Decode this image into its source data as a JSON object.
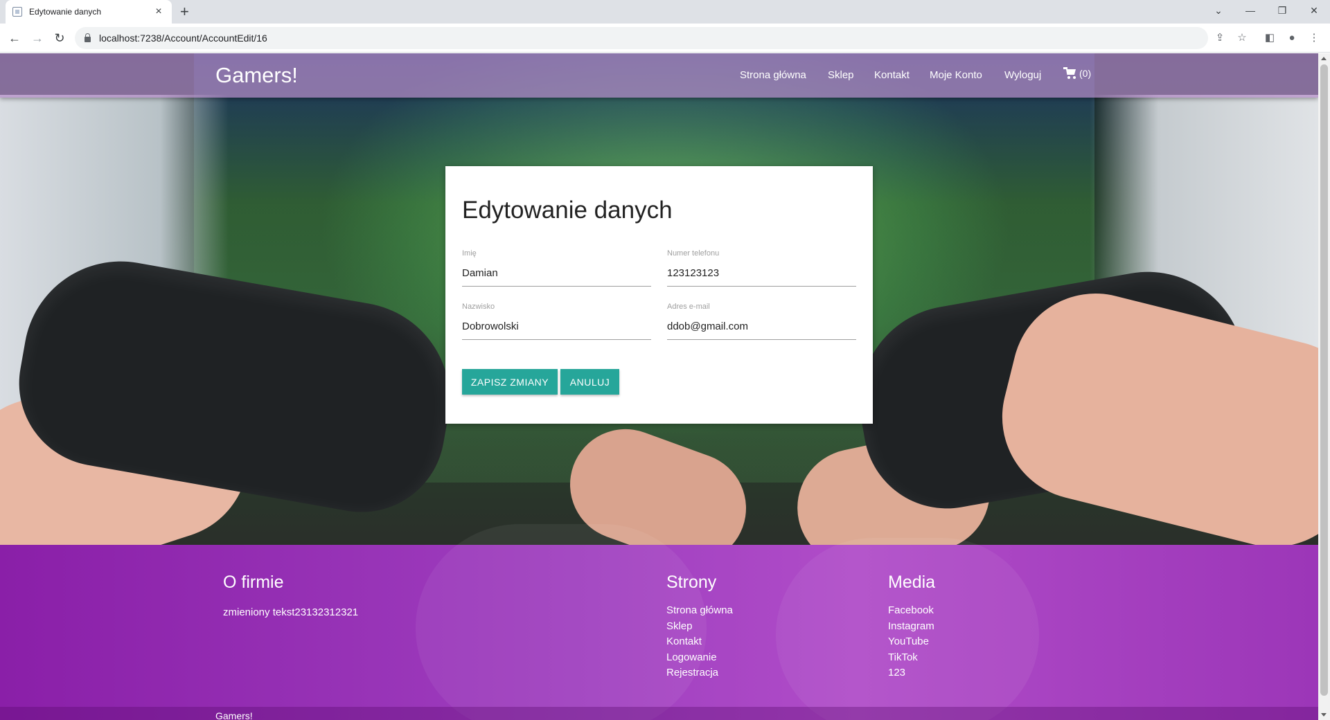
{
  "browser": {
    "tab_title": "Edytowanie danych",
    "tab_close": "×",
    "new_tab": "+",
    "url": "localhost:7238/Account/AccountEdit/16",
    "window_controls": [
      "⌄",
      "—",
      "❐",
      "✕"
    ]
  },
  "navbar": {
    "brand": "Gamers!",
    "links": [
      "Strona główna",
      "Sklep",
      "Kontakt",
      "Moje Konto",
      "Wyloguj"
    ],
    "cart_count": "(0)"
  },
  "form": {
    "title": "Edytowanie danych",
    "fields": {
      "first_name": {
        "label": "Imię",
        "value": "Damian"
      },
      "phone": {
        "label": "Numer telefonu",
        "value": "123123123"
      },
      "last_name": {
        "label": "Nazwisko",
        "value": "Dobrowolski"
      },
      "email": {
        "label": "Adres e-mail",
        "value": "ddob@gmail.com"
      }
    },
    "save_label": "ZAPISZ ZMIANY",
    "cancel_label": "ANULUJ"
  },
  "footer": {
    "about": {
      "title": "O firmie",
      "text": "zmieniony tekst23132312321"
    },
    "pages": {
      "title": "Strony",
      "links": [
        "Strona główna",
        "Sklep",
        "Kontakt",
        "Logowanie",
        "Rejestracja"
      ]
    },
    "media": {
      "title": "Media",
      "links": [
        "Facebook",
        "Instagram",
        "YouTube",
        "TikTok",
        "123"
      ]
    },
    "copyright": "Gamers!"
  },
  "colors": {
    "accent_button": "#26a69a",
    "navbar": "#b48cc8",
    "footer": "#a040c0"
  }
}
